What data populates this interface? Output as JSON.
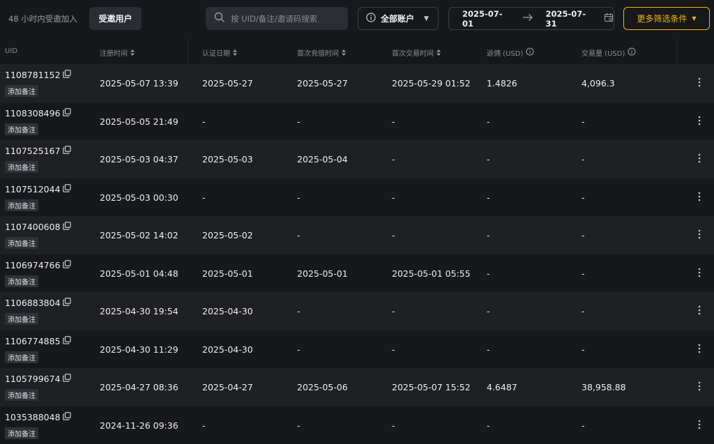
{
  "topbar": {
    "tab_recent": "48 小时内受邀加入",
    "tab_invited": "受邀用户",
    "search_placeholder": "按 UID/备注/邀请码搜索",
    "account_label": "全部账户",
    "date_from": "2025-07-01",
    "date_to": "2025-07-31",
    "more_filters": "更多筛选条件"
  },
  "table": {
    "headers": {
      "uid": "UID",
      "register_time": "注册时间",
      "verify_date": "认证日期",
      "first_deposit": "首次充值时间",
      "first_trade": "首次交易时间",
      "rebate": "返佣 (USD)",
      "volume": "交易量 (USD)"
    },
    "note_label": "添加备注",
    "rows": [
      {
        "uid": "1108781152",
        "register_time": "2025-05-07 13:39",
        "verify_date": "2025-05-27",
        "first_deposit": "2025-05-27",
        "first_trade": "2025-05-29 01:52",
        "rebate": "1.4826",
        "volume": "4,096.3"
      },
      {
        "uid": "1108308496",
        "register_time": "2025-05-05 21:49",
        "verify_date": "-",
        "first_deposit": "-",
        "first_trade": "-",
        "rebate": "-",
        "volume": "-"
      },
      {
        "uid": "1107525167",
        "register_time": "2025-05-03 04:37",
        "verify_date": "2025-05-03",
        "first_deposit": "2025-05-04",
        "first_trade": "-",
        "rebate": "-",
        "volume": "-"
      },
      {
        "uid": "1107512044",
        "register_time": "2025-05-03 00:30",
        "verify_date": "-",
        "first_deposit": "-",
        "first_trade": "-",
        "rebate": "-",
        "volume": "-"
      },
      {
        "uid": "1107400608",
        "register_time": "2025-05-02 14:02",
        "verify_date": "2025-05-02",
        "first_deposit": "-",
        "first_trade": "-",
        "rebate": "-",
        "volume": "-"
      },
      {
        "uid": "1106974766",
        "register_time": "2025-05-01 04:48",
        "verify_date": "2025-05-01",
        "first_deposit": "2025-05-01",
        "first_trade": "2025-05-01 05:55",
        "rebate": "-",
        "volume": "-"
      },
      {
        "uid": "1106883804",
        "register_time": "2025-04-30 19:54",
        "verify_date": "2025-04-30",
        "first_deposit": "-",
        "first_trade": "-",
        "rebate": "-",
        "volume": "-"
      },
      {
        "uid": "1106774885",
        "register_time": "2025-04-30 11:29",
        "verify_date": "2025-04-30",
        "first_deposit": "-",
        "first_trade": "-",
        "rebate": "-",
        "volume": "-"
      },
      {
        "uid": "1105799674",
        "register_time": "2025-04-27 08:36",
        "verify_date": "2025-04-27",
        "first_deposit": "2025-05-06",
        "first_trade": "2025-05-07 15:52",
        "rebate": "4.6487",
        "volume": "38,958.88"
      },
      {
        "uid": "1035388048",
        "register_time": "2024-11-26 09:36",
        "verify_date": "-",
        "first_deposit": "-",
        "first_trade": "-",
        "rebate": "-",
        "volume": "-"
      }
    ]
  },
  "colors": {
    "accent": "#f0b90b",
    "background": "#17181b",
    "row_alt": "#1f2024"
  },
  "icons": [
    "search-icon",
    "info-icon",
    "caret-down-icon",
    "arrow-right-icon",
    "calendar-icon",
    "copy-icon",
    "sort-icon",
    "more-vertical-icon"
  ]
}
